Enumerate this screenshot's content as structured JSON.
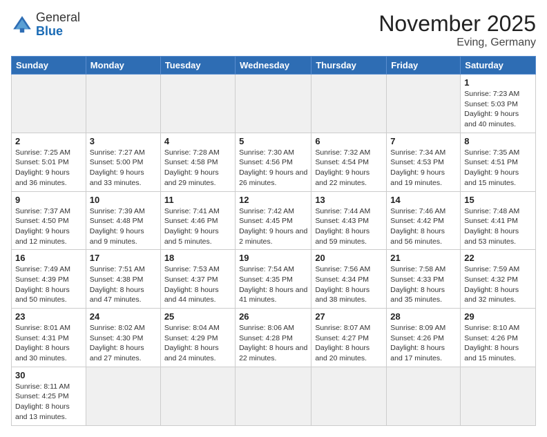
{
  "logo": {
    "general": "General",
    "blue": "Blue"
  },
  "header": {
    "month": "November 2025",
    "location": "Eving, Germany"
  },
  "weekdays": [
    "Sunday",
    "Monday",
    "Tuesday",
    "Wednesday",
    "Thursday",
    "Friday",
    "Saturday"
  ],
  "weeks": [
    [
      {
        "day": "",
        "info": ""
      },
      {
        "day": "",
        "info": ""
      },
      {
        "day": "",
        "info": ""
      },
      {
        "day": "",
        "info": ""
      },
      {
        "day": "",
        "info": ""
      },
      {
        "day": "",
        "info": ""
      },
      {
        "day": "1",
        "info": "Sunrise: 7:23 AM\nSunset: 5:03 PM\nDaylight: 9 hours and 40 minutes."
      }
    ],
    [
      {
        "day": "2",
        "info": "Sunrise: 7:25 AM\nSunset: 5:01 PM\nDaylight: 9 hours and 36 minutes."
      },
      {
        "day": "3",
        "info": "Sunrise: 7:27 AM\nSunset: 5:00 PM\nDaylight: 9 hours and 33 minutes."
      },
      {
        "day": "4",
        "info": "Sunrise: 7:28 AM\nSunset: 4:58 PM\nDaylight: 9 hours and 29 minutes."
      },
      {
        "day": "5",
        "info": "Sunrise: 7:30 AM\nSunset: 4:56 PM\nDaylight: 9 hours and 26 minutes."
      },
      {
        "day": "6",
        "info": "Sunrise: 7:32 AM\nSunset: 4:54 PM\nDaylight: 9 hours and 22 minutes."
      },
      {
        "day": "7",
        "info": "Sunrise: 7:34 AM\nSunset: 4:53 PM\nDaylight: 9 hours and 19 minutes."
      },
      {
        "day": "8",
        "info": "Sunrise: 7:35 AM\nSunset: 4:51 PM\nDaylight: 9 hours and 15 minutes."
      }
    ],
    [
      {
        "day": "9",
        "info": "Sunrise: 7:37 AM\nSunset: 4:50 PM\nDaylight: 9 hours and 12 minutes."
      },
      {
        "day": "10",
        "info": "Sunrise: 7:39 AM\nSunset: 4:48 PM\nDaylight: 9 hours and 9 minutes."
      },
      {
        "day": "11",
        "info": "Sunrise: 7:41 AM\nSunset: 4:46 PM\nDaylight: 9 hours and 5 minutes."
      },
      {
        "day": "12",
        "info": "Sunrise: 7:42 AM\nSunset: 4:45 PM\nDaylight: 9 hours and 2 minutes."
      },
      {
        "day": "13",
        "info": "Sunrise: 7:44 AM\nSunset: 4:43 PM\nDaylight: 8 hours and 59 minutes."
      },
      {
        "day": "14",
        "info": "Sunrise: 7:46 AM\nSunset: 4:42 PM\nDaylight: 8 hours and 56 minutes."
      },
      {
        "day": "15",
        "info": "Sunrise: 7:48 AM\nSunset: 4:41 PM\nDaylight: 8 hours and 53 minutes."
      }
    ],
    [
      {
        "day": "16",
        "info": "Sunrise: 7:49 AM\nSunset: 4:39 PM\nDaylight: 8 hours and 50 minutes."
      },
      {
        "day": "17",
        "info": "Sunrise: 7:51 AM\nSunset: 4:38 PM\nDaylight: 8 hours and 47 minutes."
      },
      {
        "day": "18",
        "info": "Sunrise: 7:53 AM\nSunset: 4:37 PM\nDaylight: 8 hours and 44 minutes."
      },
      {
        "day": "19",
        "info": "Sunrise: 7:54 AM\nSunset: 4:35 PM\nDaylight: 8 hours and 41 minutes."
      },
      {
        "day": "20",
        "info": "Sunrise: 7:56 AM\nSunset: 4:34 PM\nDaylight: 8 hours and 38 minutes."
      },
      {
        "day": "21",
        "info": "Sunrise: 7:58 AM\nSunset: 4:33 PM\nDaylight: 8 hours and 35 minutes."
      },
      {
        "day": "22",
        "info": "Sunrise: 7:59 AM\nSunset: 4:32 PM\nDaylight: 8 hours and 32 minutes."
      }
    ],
    [
      {
        "day": "23",
        "info": "Sunrise: 8:01 AM\nSunset: 4:31 PM\nDaylight: 8 hours and 30 minutes."
      },
      {
        "day": "24",
        "info": "Sunrise: 8:02 AM\nSunset: 4:30 PM\nDaylight: 8 hours and 27 minutes."
      },
      {
        "day": "25",
        "info": "Sunrise: 8:04 AM\nSunset: 4:29 PM\nDaylight: 8 hours and 24 minutes."
      },
      {
        "day": "26",
        "info": "Sunrise: 8:06 AM\nSunset: 4:28 PM\nDaylight: 8 hours and 22 minutes."
      },
      {
        "day": "27",
        "info": "Sunrise: 8:07 AM\nSunset: 4:27 PM\nDaylight: 8 hours and 20 minutes."
      },
      {
        "day": "28",
        "info": "Sunrise: 8:09 AM\nSunset: 4:26 PM\nDaylight: 8 hours and 17 minutes."
      },
      {
        "day": "29",
        "info": "Sunrise: 8:10 AM\nSunset: 4:26 PM\nDaylight: 8 hours and 15 minutes."
      }
    ],
    [
      {
        "day": "30",
        "info": "Sunrise: 8:11 AM\nSunset: 4:25 PM\nDaylight: 8 hours and 13 minutes."
      },
      {
        "day": "",
        "info": ""
      },
      {
        "day": "",
        "info": ""
      },
      {
        "day": "",
        "info": ""
      },
      {
        "day": "",
        "info": ""
      },
      {
        "day": "",
        "info": ""
      },
      {
        "day": "",
        "info": ""
      }
    ]
  ]
}
